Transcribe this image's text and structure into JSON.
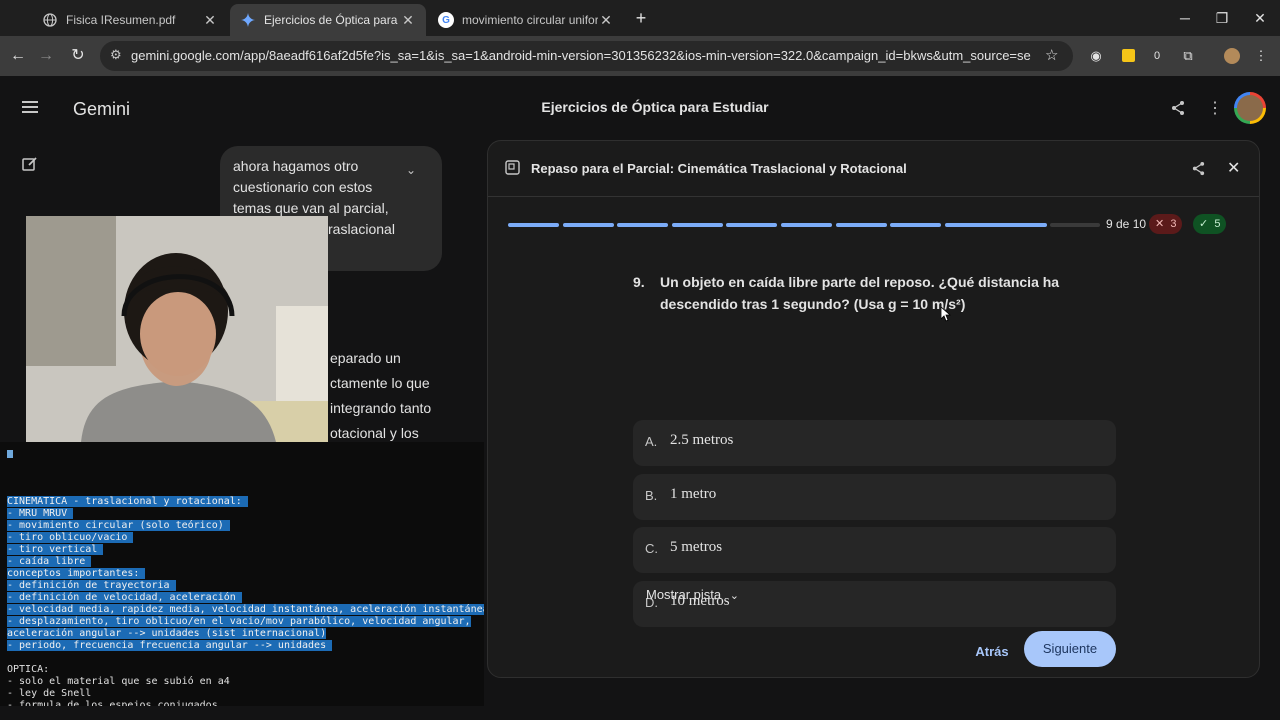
{
  "tabs": [
    {
      "title": "Fisica IResumen.pdf",
      "icon": "globe-icon"
    },
    {
      "title": "Ejercicios de Óptica para Estudi",
      "icon": "gemini-icon"
    },
    {
      "title": "movimiento circular uniforme d",
      "icon": "google-icon"
    }
  ],
  "browser": {
    "url": "gemini.google.com/app/8aeadf616af2d5fe?is_sa=1&is_sa=1&android-min-version=301356232&ios-min-version=322.0&campaign_id=bkws&utm_source=sem&utm_mediu...",
    "ext_count": "0"
  },
  "app": {
    "brand": "Gemini",
    "conversation_title": "Ejercicios de Óptica para Estudiar"
  },
  "chat": {
    "user_lines": [
      "ahora hagamos otro",
      "cuestionario con estos",
      "temas que van al parcial,",
      "raslacional"
    ],
    "reply_lines": [
      "eparado un",
      "ctamente lo que",
      "integrando tanto",
      "otacional y los"
    ]
  },
  "quiz": {
    "title": "Repaso para el Parcial: Cinemática Traslacional y Rotacional",
    "progress": {
      "current": 9,
      "total": 10,
      "label": "9 de 10",
      "wrong": "3",
      "right": "5"
    },
    "question_number": "9.",
    "question_text": "Un objeto en caída libre parte del reposo. ¿Qué distancia ha descendido tras 1 segundo? (Usa g = 10 m/s²)",
    "options": [
      {
        "letter": "A.",
        "text": "2.5 metros"
      },
      {
        "letter": "B.",
        "text": "1 metro"
      },
      {
        "letter": "C.",
        "text": "5 metros"
      },
      {
        "letter": "D.",
        "text": "10 metros"
      }
    ],
    "hint_label": "Mostrar pista",
    "back_label": "Atrás",
    "next_label": "Siguiente"
  },
  "terminal": {
    "lines": [
      {
        "text": "CINEMATICA - traslacional y rotacional: ",
        "selected": true
      },
      {
        "text": "- MRU MRUV ",
        "selected": true
      },
      {
        "text": "- movimiento circular (solo teórico) ",
        "selected": true
      },
      {
        "text": "- tiro oblicuo/vacio ",
        "selected": true
      },
      {
        "text": "- tiro vertical ",
        "selected": true
      },
      {
        "text": "- caída libre ",
        "selected": true
      },
      {
        "text": "conceptos importantes: ",
        "selected": true
      },
      {
        "text": "- definición de trayectoria ",
        "selected": true
      },
      {
        "text": "- definición de velocidad, aceleración ",
        "selected": true
      },
      {
        "text": "- velocidad media, rapidez media, velocidad instantánea, aceleración instantánea",
        "selected": true
      },
      {
        "text": "- desplazamiento, tiro oblicuo/en el vacio/mov parabólico, velocidad angular,",
        "selected": true
      },
      {
        "text": "aceleración angular --> unidades (sist internacional)",
        "selected": true
      },
      {
        "text": "- periodo, frecuencia frecuencia angular --> unidades ",
        "selected": true
      },
      {
        "text": "",
        "selected": false
      },
      {
        "text": "OPTICA:",
        "selected": false
      },
      {
        "text": "- solo el material que se subió en a4",
        "selected": false
      },
      {
        "text": "- ley de Snell",
        "selected": false
      },
      {
        "text": "- formula de los espejos conjugados",
        "selected": false
      }
    ]
  }
}
